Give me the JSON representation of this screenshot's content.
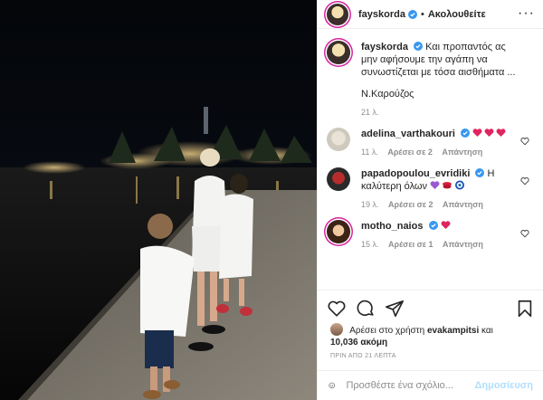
{
  "post_author": {
    "username": "fayskorda",
    "follow_label": "Ακολουθείτε",
    "separator": "•"
  },
  "caption": {
    "username": "fayskorda",
    "text": "Και προπαντός ας μην αφήσουμε την αγάπη να συνωστίζεται με τόσα αισθήματα ...",
    "signature": "Ν.Καρούζος",
    "time": "21 λ."
  },
  "comments": [
    {
      "username": "adelina_varthakouri",
      "emojis": [
        "red-heart",
        "red-heart",
        "red-heart"
      ],
      "time": "11 λ.",
      "likes": "Αρέσει σε 2",
      "reply": "Απάντηση"
    },
    {
      "username": "papadopoulou_evridiki",
      "text": "Η καλύτερη όλων",
      "emojis": [
        "purple-heart",
        "kiss-mark",
        "nazar-amulet"
      ],
      "time": "19 λ.",
      "likes": "Αρέσει σε 2",
      "reply": "Απάντηση"
    },
    {
      "username": "motho_naios",
      "emojis": [
        "red-heart"
      ],
      "time": "15 λ.",
      "likes": "Αρέσει σε 1",
      "reply": "Απάντηση"
    }
  ],
  "likes": {
    "prefix": "Αρέσει στο χρήστη",
    "user": "evakampitsi",
    "connector": "και",
    "count": "10,036 ακόμη"
  },
  "timestamp": "ΠΡΙΝ ΑΠΟ 21 ΛΕΠΤΑ",
  "add_comment": {
    "placeholder": "Προσθέστε ένα σχόλιο...",
    "post_label": "Δημοσίευση"
  },
  "colors": {
    "verified": "#3897f0",
    "heart_red": "#ed4956",
    "post_disabled": "#b2dffc",
    "meta_gray": "#8e8e8e"
  },
  "icons": [
    "verified-badge-icon",
    "more-options-icon",
    "heart-icon",
    "comment-icon",
    "share-icon",
    "bookmark-icon",
    "emoji-icon"
  ]
}
